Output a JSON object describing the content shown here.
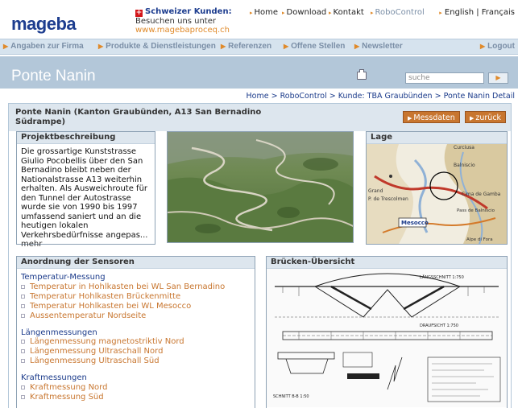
{
  "header": {
    "logo": "mageba",
    "swiss_title": "Schweizer Kunden:",
    "swiss_sub": "Besuchen uns unter",
    "swiss_url": "www.magebaproceq.ch",
    "top_links": [
      "Home",
      "Download",
      "Kontakt",
      "RoboControl"
    ],
    "lang_en": "English",
    "lang_sep": "|",
    "lang_fr": "Français"
  },
  "mainnav": {
    "items": [
      "Angaben zur Firma",
      "Produkte & Dienstleistungen",
      "Referenzen",
      "Offene Stellen",
      "Newsletter"
    ],
    "logout": "Logout"
  },
  "titlebar": {
    "title": "Ponte Nanin",
    "search_placeholder": "suche"
  },
  "breadcrumb": "Home > RoboControl > Kunde: TBA Graubünden > Ponte Nanin Detail",
  "card": {
    "title": "Ponte Nanin (Kanton Graubünden, A13 San Bernadino Südrampe)",
    "btn_messdaten": "Messdaten",
    "btn_zurueck": "zurück"
  },
  "projekt": {
    "heading": "Projektbeschreibung",
    "text": "Die grossartige Kunststrasse Giulio Pocobellis über den San Bernadino bleibt neben der Nationalstrasse A13 weiterhin erhalten. Als Ausweichroute für den Tunnel der Autostrasse wurde sie von 1990 bis 1997 umfassend saniert und an die heutigen lokalen Verkehrsbedürfnisse angepas...",
    "more": "mehr"
  },
  "lage": {
    "heading": "Lage",
    "map_labels": [
      "Curciusa",
      "Balniscio",
      "Grand",
      "P. de Trescolmen",
      "Cima de Gamba",
      "Pass de Balniscio",
      "Mesocco",
      "Alpe di Fora"
    ]
  },
  "sensoren": {
    "heading": "Anordnung der Sensoren",
    "groups": [
      {
        "name": "Temperatur-Messung",
        "items": [
          "Temperatur in Hohlkasten bei WL San Bernadino",
          "Temperatur Hohlkasten Brückenmitte",
          "Temperatur Hohlkasten bei WL Mesocco",
          "Aussentemperatur Nordseite"
        ]
      },
      {
        "name": "Längenmessungen",
        "items": [
          "Längenmessung magnetostriktiv Nord",
          "Längenmessung Ultraschall Nord",
          "Längenmessung Ultraschall Süd"
        ]
      },
      {
        "name": "Kraftmessungen",
        "items": [
          "Kraftmessung Nord",
          "Kraftmessung Süd"
        ]
      }
    ]
  },
  "bruecke": {
    "heading": "Brücken-Übersicht",
    "drawing_labels": [
      "LÄNGSSCHNITT 1:750",
      "DRAUFSICHT 1:750",
      "SCHNITT B-B 1:50"
    ]
  },
  "colors": {
    "brand_blue": "#1d3d8f",
    "accent_orange": "#c8762f",
    "nav_bg": "#d6e3ee",
    "title_bg": "#b3c7d9"
  }
}
